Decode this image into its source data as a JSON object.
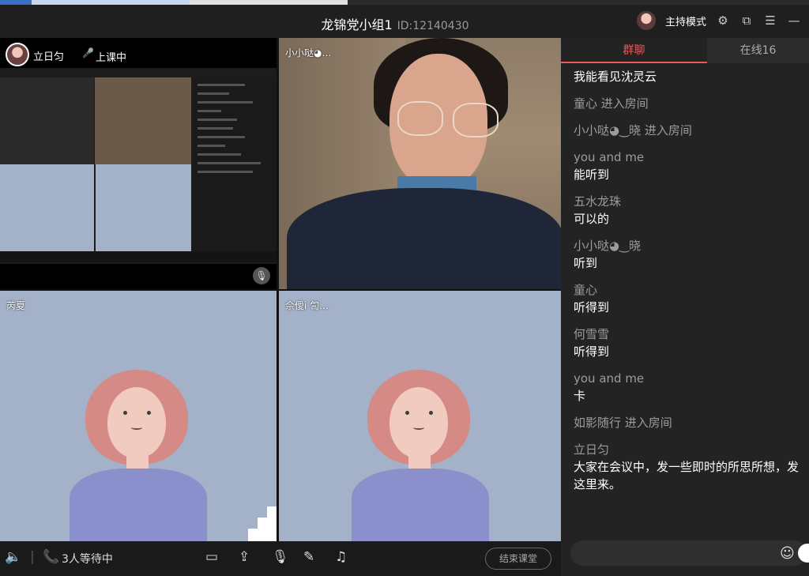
{
  "title": {
    "name": "龙锦党小组1",
    "id": "ID:12140430"
  },
  "header": {
    "mode": "主持模式"
  },
  "share_tile": {
    "name": "立日匀",
    "status": "上课中"
  },
  "tiles": {
    "video_name": "小小哒◕…",
    "cartoon1_name": "芮夏",
    "cartoon2_name": "佘僾i 訇…"
  },
  "toolbar": {
    "waiting": "3人等待中",
    "end_label": "结束课堂"
  },
  "chat": {
    "tab_group": "群聊",
    "tab_online": "在线16",
    "messages": [
      {
        "type": "text",
        "who": "",
        "text": "我能看见沈灵云"
      },
      {
        "type": "sys",
        "text": "童心 进入房间"
      },
      {
        "type": "sys",
        "text": "小小哒◕‿晓 进入房间"
      },
      {
        "type": "text",
        "who": "you and me",
        "text": "能听到"
      },
      {
        "type": "text",
        "who": "五水龙珠",
        "text": "可以的"
      },
      {
        "type": "text",
        "who": "小小哒◕‿晓",
        "text": "听到"
      },
      {
        "type": "text",
        "who": "童心",
        "text": "听得到"
      },
      {
        "type": "text",
        "who": "何雪雪",
        "text": "听得到"
      },
      {
        "type": "text",
        "who": "you and me",
        "text": "卡"
      },
      {
        "type": "sys",
        "text": "如影随行 进入房间"
      },
      {
        "type": "text",
        "who": "立日匀",
        "text": "大家在会议中，发一些即时的所思所想，发",
        "text2": "这里来。"
      }
    ]
  },
  "colors": {
    "accent": "#e65a5a",
    "cartoon_bg": "#a3b1c9"
  }
}
